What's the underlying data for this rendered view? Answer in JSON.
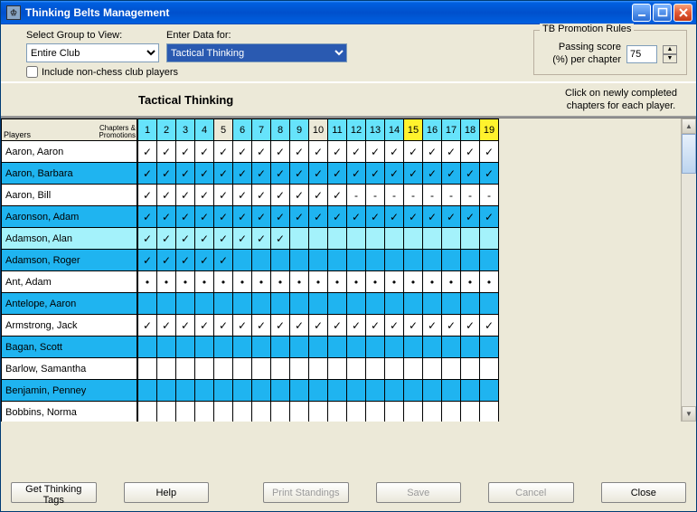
{
  "window": {
    "title": "Thinking Belts Management"
  },
  "controls": {
    "select_group_label": "Select Group to View:",
    "select_group_value": "Entire Club",
    "enter_data_label": "Enter Data for:",
    "enter_data_value": "Tactical Thinking",
    "include_nonchess_label": "Include non-chess club players"
  },
  "rules": {
    "legend": "TB Promotion Rules",
    "passing_label": "Passing score (%) per chapter",
    "passing_value": "75"
  },
  "grid": {
    "title": "Tactical Thinking",
    "hint": "Click on newly completed chapters for each player.",
    "players_header_top": "Players",
    "players_header_right": "Chapters & Promotions",
    "columns": [
      {
        "n": "1",
        "style": "norm"
      },
      {
        "n": "2",
        "style": "norm"
      },
      {
        "n": "3",
        "style": "norm"
      },
      {
        "n": "4",
        "style": "norm"
      },
      {
        "n": "5",
        "style": "inactive"
      },
      {
        "n": "6",
        "style": "norm"
      },
      {
        "n": "7",
        "style": "norm"
      },
      {
        "n": "8",
        "style": "norm"
      },
      {
        "n": "9",
        "style": "norm"
      },
      {
        "n": "10",
        "style": "inactive"
      },
      {
        "n": "11",
        "style": "norm"
      },
      {
        "n": "12",
        "style": "norm"
      },
      {
        "n": "13",
        "style": "norm"
      },
      {
        "n": "14",
        "style": "norm"
      },
      {
        "n": "15",
        "style": "yellow"
      },
      {
        "n": "16",
        "style": "norm"
      },
      {
        "n": "17",
        "style": "norm"
      },
      {
        "n": "18",
        "style": "norm"
      },
      {
        "n": "19",
        "style": "yellow"
      }
    ],
    "rows": [
      {
        "name": "Aaron, Aaron",
        "rc": "white",
        "cells": [
          "✓",
          "✓",
          "✓",
          "✓",
          "✓",
          "✓",
          "✓",
          "✓",
          "✓",
          "✓",
          "✓",
          "✓",
          "✓",
          "✓",
          "✓",
          "✓",
          "✓",
          "✓",
          "✓"
        ]
      },
      {
        "name": "Aaron, Barbara",
        "rc": "bright",
        "cells": [
          "✓",
          "✓",
          "✓",
          "✓",
          "✓",
          "✓",
          "✓",
          "✓",
          "✓",
          "✓",
          "✓",
          "✓",
          "✓",
          "✓",
          "✓",
          "✓",
          "✓",
          "✓",
          "✓"
        ]
      },
      {
        "name": "Aaron, Bill",
        "rc": "white",
        "cells": [
          "✓",
          "✓",
          "✓",
          "✓",
          "✓",
          "✓",
          "✓",
          "✓",
          "✓",
          "✓",
          "✓",
          "-",
          "-",
          "-",
          "-",
          "-",
          "-",
          "-",
          "-"
        ]
      },
      {
        "name": "Aaronson, Adam",
        "rc": "bright",
        "cells": [
          "✓",
          "✓",
          "✓",
          "✓",
          "✓",
          "✓",
          "✓",
          "✓",
          "✓",
          "✓",
          "✓",
          "✓",
          "✓",
          "✓",
          "✓",
          "✓",
          "✓",
          "✓",
          "✓"
        ]
      },
      {
        "name": "Adamson, Alan",
        "rc": "pale",
        "cells": [
          "✓",
          "✓",
          "✓",
          "✓",
          "✓",
          "✓",
          "✓",
          "✓",
          "",
          "",
          "",
          "",
          "",
          "",
          "",
          "",
          "",
          "",
          ""
        ]
      },
      {
        "name": "Adamson, Roger",
        "rc": "bright",
        "cells": [
          "✓",
          "✓",
          "✓",
          "✓",
          "✓",
          "",
          "",
          "",
          "",
          "",
          "",
          "",
          "",
          "",
          "",
          "",
          "",
          "",
          ""
        ]
      },
      {
        "name": "Ant, Adam",
        "rc": "white",
        "cells": [
          "•",
          "•",
          "•",
          "•",
          "•",
          "•",
          "•",
          "•",
          "•",
          "•",
          "•",
          "•",
          "•",
          "•",
          "•",
          "•",
          "•",
          "•",
          "•"
        ]
      },
      {
        "name": "Antelope, Aaron",
        "rc": "bright",
        "cells": [
          "",
          "",
          "",
          "",
          "",
          "",
          "",
          "",
          "",
          "",
          "",
          "",
          "",
          "",
          "",
          "",
          "",
          "",
          ""
        ]
      },
      {
        "name": "Armstrong, Jack",
        "rc": "white",
        "cells": [
          "✓",
          "✓",
          "✓",
          "✓",
          "✓",
          "✓",
          "✓",
          "✓",
          "✓",
          "✓",
          "✓",
          "✓",
          "✓",
          "✓",
          "✓",
          "✓",
          "✓",
          "✓",
          "✓"
        ]
      },
      {
        "name": "Bagan, Scott",
        "rc": "bright",
        "cells": [
          "",
          "",
          "",
          "",
          "",
          "",
          "",
          "",
          "",
          "",
          "",
          "",
          "",
          "",
          "",
          "",
          "",
          "",
          ""
        ]
      },
      {
        "name": "Barlow, Samantha",
        "rc": "white",
        "cells": [
          "",
          "",
          "",
          "",
          "",
          "",
          "",
          "",
          "",
          "",
          "",
          "",
          "",
          "",
          "",
          "",
          "",
          "",
          ""
        ]
      },
      {
        "name": "Benjamin, Penney",
        "rc": "bright",
        "cells": [
          "",
          "",
          "",
          "",
          "",
          "",
          "",
          "",
          "",
          "",
          "",
          "",
          "",
          "",
          "",
          "",
          "",
          "",
          ""
        ]
      },
      {
        "name": "Bobbins, Norma",
        "rc": "white",
        "cells": [
          "",
          "",
          "",
          "",
          "",
          "",
          "",
          "",
          "",
          "",
          "",
          "",
          "",
          "",
          "",
          "",
          "",
          "",
          ""
        ]
      }
    ]
  },
  "buttons": {
    "get_tags": "Get Thinking Tags",
    "help": "Help",
    "print": "Print Standings",
    "save": "Save",
    "cancel": "Cancel",
    "close": "Close"
  }
}
